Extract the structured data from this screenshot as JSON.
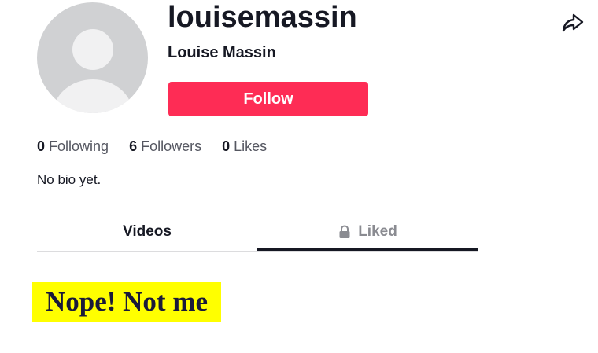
{
  "profile": {
    "username": "louisemassin",
    "display_name": "Louise Massin",
    "follow_label": "Follow",
    "bio": "No bio yet."
  },
  "stats": [
    {
      "value": "0",
      "label": "Following"
    },
    {
      "value": "6",
      "label": "Followers"
    },
    {
      "value": "0",
      "label": "Likes"
    }
  ],
  "tabs": [
    {
      "label": "Videos"
    },
    {
      "label": "Liked",
      "icon": "lock-icon"
    }
  ],
  "overlay_text": "Nope! Not me",
  "icons": {
    "share": "share-arrow-icon"
  },
  "colors": {
    "follow_button": "#fe2c55",
    "highlight_background": "#ffff00",
    "text_primary": "#161823",
    "text_secondary": "#555761",
    "tab_inactive": "#8a8b91"
  }
}
